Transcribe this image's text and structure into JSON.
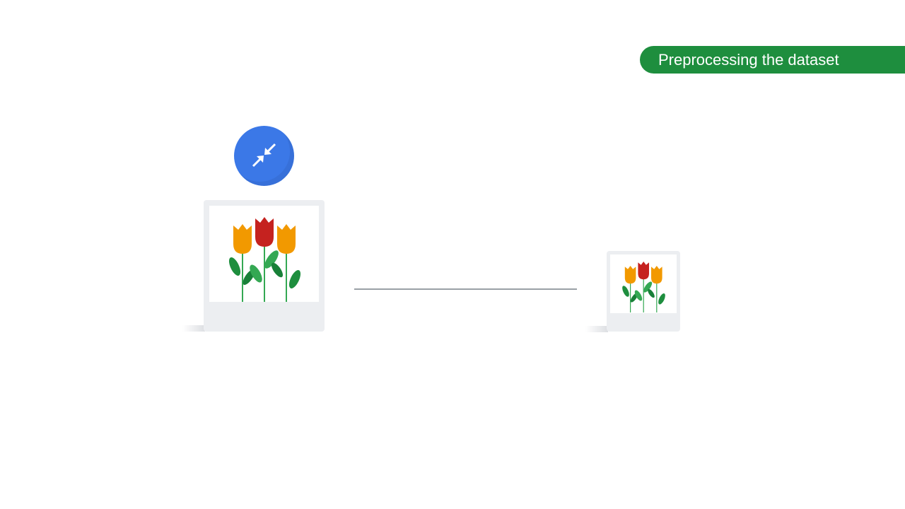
{
  "badge": {
    "label": "Preprocessing the dataset",
    "color": "#1e8e3e"
  },
  "icons": {
    "compress": "compress-arrows-icon",
    "image": "tulips-image-icon"
  },
  "colors": {
    "accent_blue": "#3b78e7",
    "tulip_orange": "#f29900",
    "tulip_red": "#c5221f",
    "leaf_green": "#1e8e3e"
  }
}
